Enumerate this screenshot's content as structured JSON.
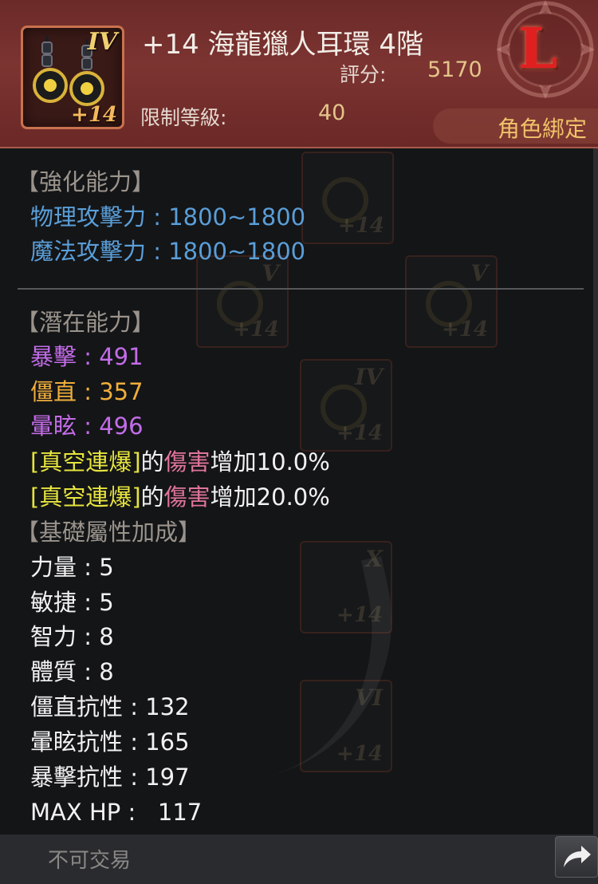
{
  "header": {
    "item_name": "+14 海龍獵人耳環 4階",
    "icon_tier": "IV",
    "icon_enhance": "+14",
    "score_label": "評分:",
    "score_value": "5170",
    "level_label": "限制等級:",
    "level_value": "40",
    "grade": "L",
    "bind_status": "角色綁定"
  },
  "sections": {
    "enhance": {
      "title": "【強化能力】",
      "lines": [
        "物理攻擊力 : 1800~1800",
        "魔法攻擊力 : 1800~1800"
      ]
    },
    "potential": {
      "title": "【潛在能力】",
      "stats": [
        "暴擊 : 491",
        "僵直 : 357",
        "暈眩 : 496"
      ],
      "skill_lines": [
        {
          "skill": "[真空連爆]",
          "of": "的",
          "effect": "傷害",
          "bonus": "增加10.0%"
        },
        {
          "skill": "[真空連爆]",
          "of": "的",
          "effect": "傷害",
          "bonus": "增加20.0%"
        }
      ]
    },
    "base": {
      "title": "【基礎屬性加成】",
      "lines": [
        "力量 : 5",
        "敏捷 : 5",
        "智力 : 8",
        "體質 : 8",
        "僵直抗性 : 132",
        "暈眩抗性 : 165",
        "暴擊抗性 : 197",
        "MAX HP :   117"
      ]
    }
  },
  "footer": {
    "trade_status": "不可交易",
    "share_icon": "arrow-curved-right-icon"
  },
  "background": {
    "ghost_tiers": [
      "V",
      "V",
      "IV",
      "X",
      "VI"
    ],
    "ghost_enhance": "+14"
  },
  "colors": {
    "header_bg": "#7c3431",
    "panel_bg": "#141517",
    "section_title": "#9a938c",
    "enhance_blue": "#5a9ed8",
    "crit_purple": "#c26ce8",
    "stagger_orange": "#efae3c",
    "skill_yellow": "#e6e43e",
    "damage_pink": "#e0749a",
    "grade_red": "#e02020",
    "bind_gold": "#f0c36a"
  }
}
